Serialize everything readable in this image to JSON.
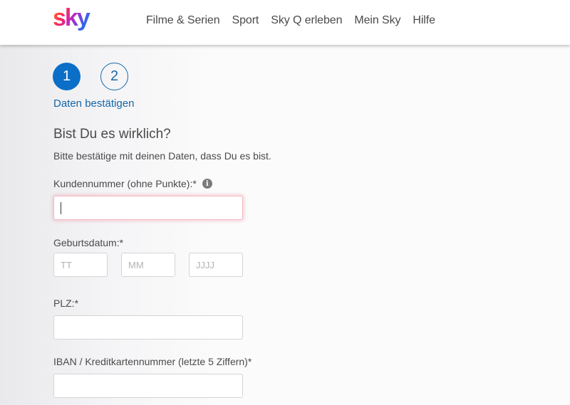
{
  "header": {
    "logo_text": "sky",
    "nav": [
      "Filme & Serien",
      "Sport",
      "Sky Q erleben",
      "Mein Sky",
      "Hilfe"
    ]
  },
  "steps": {
    "items": [
      "1",
      "2"
    ],
    "active_index": 0,
    "current_label": "Daten bestätigen"
  },
  "form": {
    "title": "Bist Du es wirklich?",
    "subtitle": "Bitte bestätige mit deinen Daten, dass Du es bist.",
    "customer_number": {
      "label": "Kundennummer (ohne Punkte):*",
      "value": "",
      "info_icon": "info-icon"
    },
    "birthdate": {
      "label": "Geburtsdatum:*",
      "day_placeholder": "TT",
      "month_placeholder": "MM",
      "year_placeholder": "JJJJ"
    },
    "zip": {
      "label": "PLZ:*",
      "value": ""
    },
    "iban": {
      "label": "IBAN / Kreditkartennummer (letzte 5 Ziffern)*",
      "value": ""
    }
  },
  "colors": {
    "accent_blue": "#0b6fc7",
    "focus_pink": "#f2b8c2"
  }
}
